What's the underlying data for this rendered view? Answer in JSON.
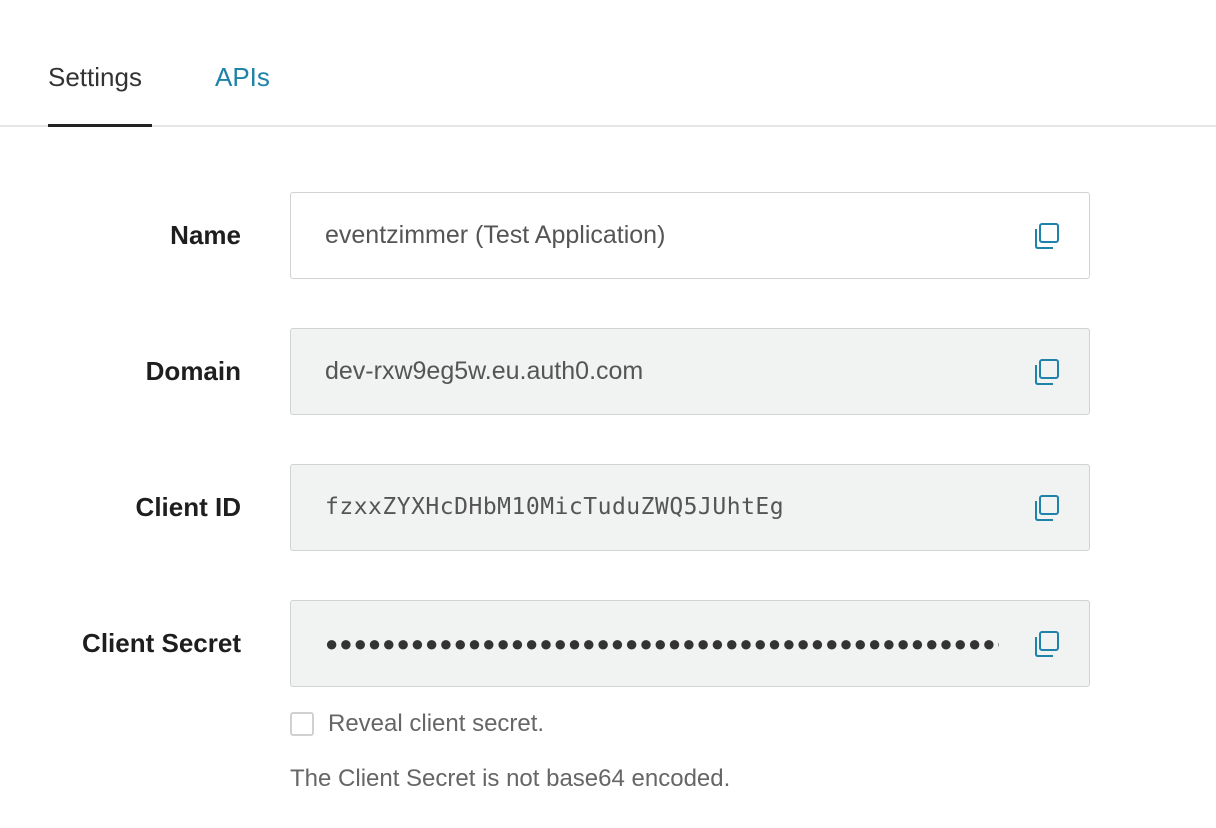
{
  "tabs": {
    "settings_label": "Settings",
    "apis_label": "APIs",
    "active": "Settings"
  },
  "fields": {
    "name": {
      "label": "Name",
      "value": "eventzimmer (Test Application)"
    },
    "domain": {
      "label": "Domain",
      "value": "dev-rxw9eg5w.eu.auth0.com"
    },
    "client_id": {
      "label": "Client ID",
      "value": "fzxxZYXHcDHbM10MicTuduZWQ5JUhtEg"
    },
    "client_secret": {
      "label": "Client Secret",
      "value": "●●●●●●●●●●●●●●●●●●●●●●●●●●●●●●●●●●●●●●●●●●●●●●●●●●●●●●●●●●●●●●●●"
    }
  },
  "reveal": {
    "label": "Reveal client secret.",
    "checked": false
  },
  "help_text": "The Client Secret is not base64 encoded.",
  "colors": {
    "accent": "#1f82a8",
    "text": "#1e1e1e",
    "muted": "#666666",
    "readonly_bg": "#f1f2f2",
    "border": "#d0d2d3"
  },
  "icons": {
    "copy": "copy-icon"
  }
}
